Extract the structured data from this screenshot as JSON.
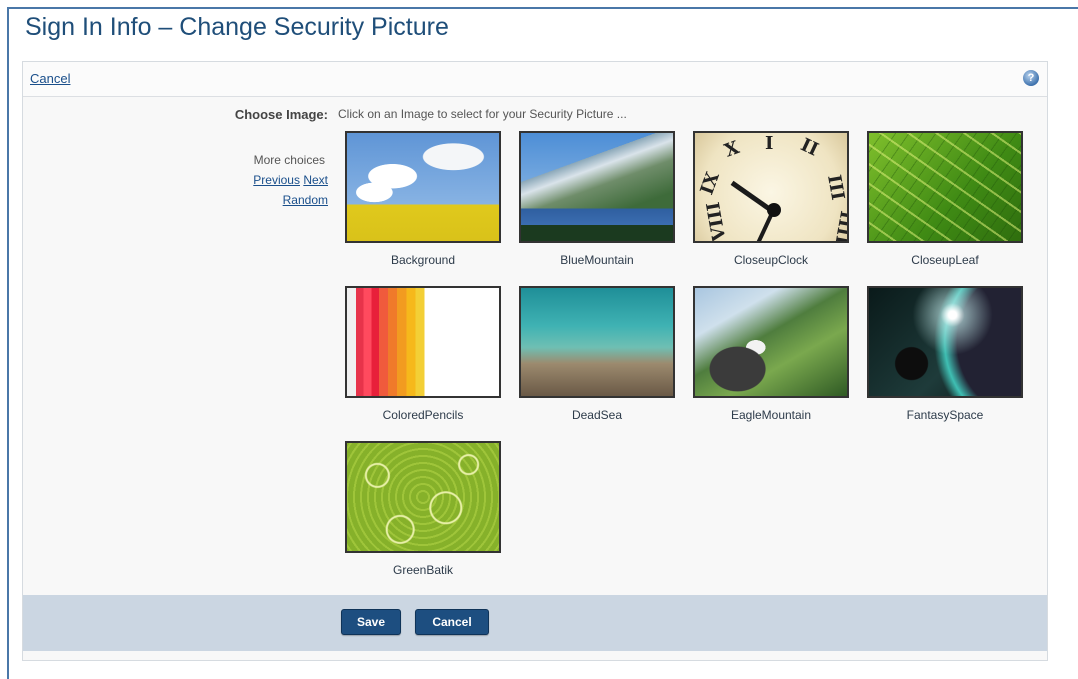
{
  "page": {
    "title": "Sign In Info – Change Security Picture"
  },
  "toolbar": {
    "cancel_link": "Cancel",
    "help_icon": "help-icon"
  },
  "chooser": {
    "label": "Choose Image:",
    "instruction": "Click on an Image to select for your Security Picture ...",
    "more_choices_label": "More choices",
    "previous_link": "Previous",
    "next_link": "Next",
    "random_link": "Random"
  },
  "images": [
    {
      "name": "Background"
    },
    {
      "name": "BlueMountain"
    },
    {
      "name": "CloseupClock"
    },
    {
      "name": "CloseupLeaf"
    },
    {
      "name": "ColoredPencils"
    },
    {
      "name": "DeadSea"
    },
    {
      "name": "EagleMountain"
    },
    {
      "name": "FantasySpace"
    },
    {
      "name": "GreenBatik"
    }
  ],
  "footer": {
    "save_label": "Save",
    "cancel_label": "Cancel"
  },
  "colors": {
    "title": "#1f4e79",
    "link": "#1a4f8b",
    "button": "#1d4e80",
    "footer_bar": "#cbd6e2",
    "frame_border": "#4a77a8"
  }
}
